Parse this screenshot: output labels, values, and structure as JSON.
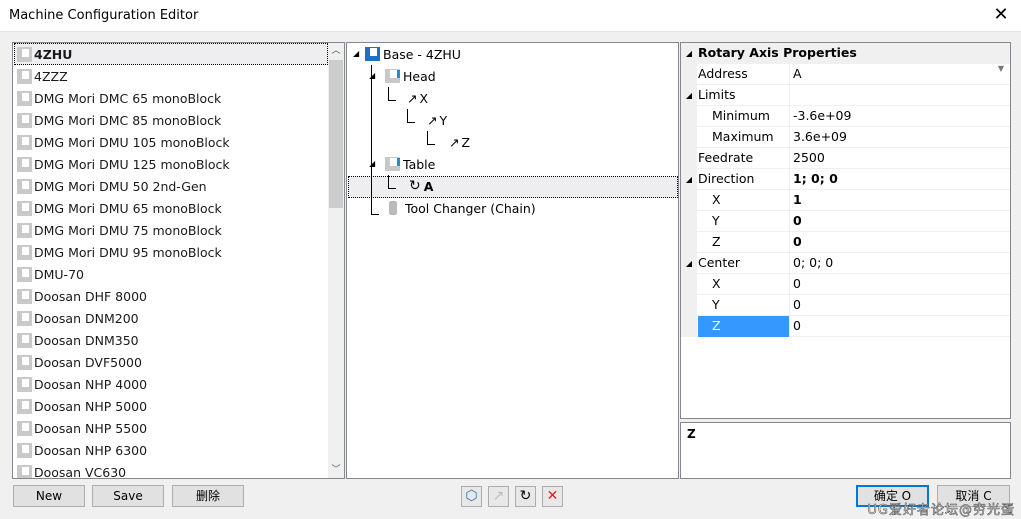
{
  "window": {
    "title": "Machine Configuration Editor",
    "close": "✕"
  },
  "machines": [
    "4ZHU",
    "4ZZZ",
    "DMG Mori DMC 65 monoBlock",
    "DMG Mori DMC 85 monoBlock",
    "DMG Mori DMU 105 monoBlock",
    "DMG Mori DMU 125 monoBlock",
    "DMG Mori DMU 50 2nd-Gen",
    "DMG Mori DMU 65 monoBlock",
    "DMG Mori DMU 75 monoBlock",
    "DMG Mori DMU 95 monoBlock",
    "DMU-70",
    "Doosan DHF 8000",
    "Doosan DNM200",
    "Doosan DNM350",
    "Doosan DVF5000",
    "Doosan NHP 4000",
    "Doosan NHP 5000",
    "Doosan NHP 5500",
    "Doosan NHP 6300",
    "Doosan VC630"
  ],
  "selected_machine": "4ZHU",
  "tree": {
    "base": "Base - 4ZHU",
    "head": "Head",
    "x": "X",
    "y": "Y",
    "z": "Z",
    "table": "Table",
    "a": "A",
    "tool_changer": "Tool Changer (Chain)"
  },
  "properties": {
    "category": "Rotary Axis Properties",
    "rows": [
      {
        "label": "Address",
        "value": "A"
      },
      {
        "label": "Limits",
        "value": ""
      },
      {
        "label": "Minimum",
        "value": "-3.6e+09"
      },
      {
        "label": "Maximum",
        "value": "3.6e+09"
      },
      {
        "label": "Feedrate",
        "value": "2500"
      },
      {
        "label": "Direction",
        "value": "1; 0; 0"
      },
      {
        "label": "X",
        "value": "1"
      },
      {
        "label": "Y",
        "value": "0"
      },
      {
        "label": "Z",
        "value": "0"
      },
      {
        "label": "Center",
        "value": "0; 0; 0"
      },
      {
        "label": "X",
        "value": "0"
      },
      {
        "label": "Y",
        "value": "0"
      },
      {
        "label": "Z",
        "value": "0"
      }
    ],
    "description": "Z"
  },
  "buttons": {
    "new": "New",
    "save": "Save",
    "delete": "删除",
    "ok": "确定 O",
    "cancel": "取消 C"
  },
  "watermark": "UG爱好者论坛@穷光蛋"
}
